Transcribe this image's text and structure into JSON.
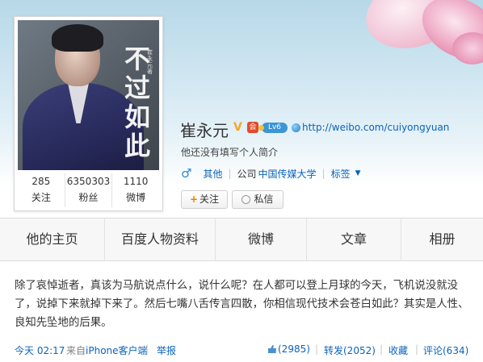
{
  "profile": {
    "name": "崔永元",
    "verified_mark": "V",
    "member_mark": "会",
    "level_badge": "Lv6",
    "url": "http://weibo.com/cuiyongyuan",
    "bio": "他还没有填写个人简介",
    "gender": "male",
    "location": "其他",
    "company_prefix": "公司",
    "company": "中国传媒大学",
    "tags_label": "标签",
    "follow_label": "关注",
    "follow_plus": "+",
    "message_label": "私信",
    "cover_title": "不过如此",
    "cover_small_text": "崔永元著"
  },
  "stats": [
    {
      "count": "285",
      "label": "关注"
    },
    {
      "count": "6350303",
      "label": "粉丝"
    },
    {
      "count": "1110",
      "label": "微博"
    }
  ],
  "tabs": [
    {
      "label": "他的主页"
    },
    {
      "label": "百度人物资料"
    },
    {
      "label": "微博"
    },
    {
      "label": "文章"
    },
    {
      "label": "相册"
    }
  ],
  "post": {
    "text": "除了哀悼逝者，真该为马航说点什么，说什么呢？在人都可以登上月球的今天，飞机说没就没了，说掉下来就掉下来了。然后七嘴八舌传言四散，你相信现代技术会苍白如此？其实是人性、良知先坠地的后果。",
    "time": "今天 02:17",
    "source_prefix": "来自",
    "source_app": "iPhone客户端",
    "report": "举报",
    "likes": "(2985)",
    "reposts": "转发(2052)",
    "favorite": "收藏",
    "comments": "评论(634)",
    "separator": "|"
  },
  "colors": {
    "link": "#0a63bd",
    "verified": "#f5a623",
    "follow_plus": "#f07e00"
  }
}
